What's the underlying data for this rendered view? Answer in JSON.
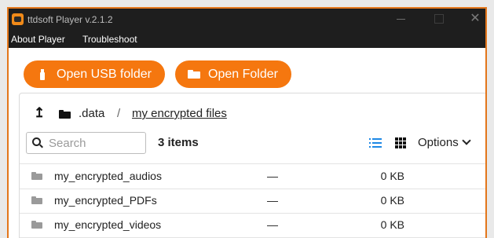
{
  "window": {
    "title": "ttdsoft Player v.2.1.2",
    "close_glyph": "✕"
  },
  "menu": [
    "About Player",
    "Troubleshoot"
  ],
  "actions": {
    "open_usb_label": "Open USB folder",
    "open_folder_label": "Open Folder"
  },
  "breadcrumb": {
    "up_glyph": "↥",
    "root": ".data",
    "separator": "/",
    "current": "my encrypted files"
  },
  "toolbar": {
    "search_placeholder": "Search",
    "item_count": "3 items",
    "options_label": "Options"
  },
  "files": [
    {
      "name": "my_encrypted_audios",
      "modified": "—",
      "size": "0 KB"
    },
    {
      "name": "my_encrypted_PDFs",
      "modified": "—",
      "size": "0 KB"
    },
    {
      "name": "my_encrypted_videos",
      "modified": "—",
      "size": "0 KB"
    }
  ],
  "colors": {
    "accent": "#f5770f",
    "window_border": "#e3761b",
    "titlebar": "#1e1e1e",
    "list_view_active": "#1e88e5"
  }
}
